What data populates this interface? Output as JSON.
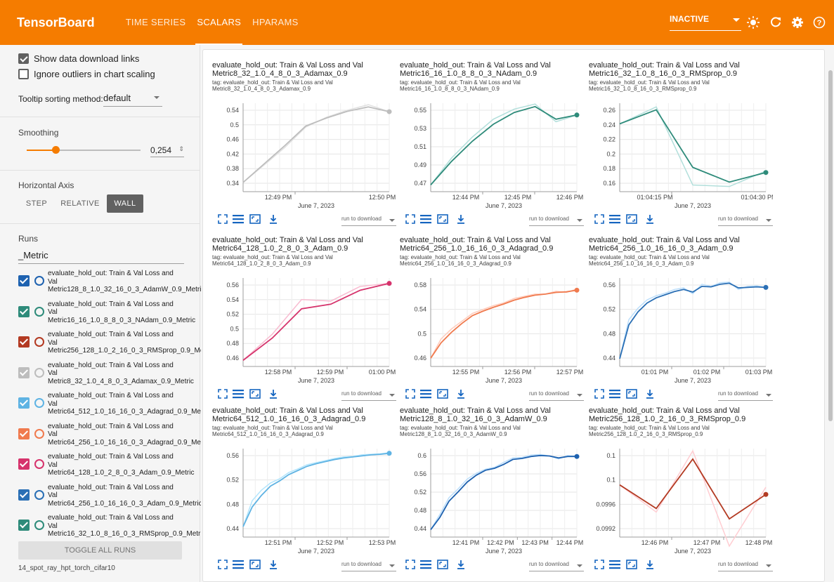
{
  "header": {
    "brand": "TensorBoard",
    "tabs": [
      {
        "label": "TIME SERIES",
        "active": false
      },
      {
        "label": "SCALARS",
        "active": true
      },
      {
        "label": "HPARAMS",
        "active": false
      }
    ],
    "run_select": "INACTIVE",
    "bg_color": "#f57c00"
  },
  "sidebar": {
    "show_download_links": "Show data download links",
    "ignore_outliers": "Ignore outliers in chart scaling",
    "tooltip_label": "Tooltip sorting method:",
    "tooltip_value": "default",
    "smoothing_label": "Smoothing",
    "smoothing_value": "0,254",
    "smoothing_fraction": 0.254,
    "haxis_label": "Horizontal Axis",
    "haxis_options": [
      "STEP",
      "RELATIVE",
      "WALL"
    ],
    "haxis_selected": "WALL",
    "runs_label": "Runs",
    "runs_filter": "_Metric",
    "runs": [
      {
        "label": "evaluate_hold_out: Train & Val Loss and Val Metric128_8_1.0_32_16_0_3_AdamW_0.9_Metric",
        "color": "#1e62b0"
      },
      {
        "label": "evaluate_hold_out: Train & Val Loss and Val Metric16_16_1.0_8_8_0_3_NAdam_0.9_Metric",
        "color": "#2e8b7a"
      },
      {
        "label": "evaluate_hold_out: Train & Val Loss and Val Metric256_128_1.0_2_16_0_3_RMSprop_0.9_Metric",
        "color": "#b33a22"
      },
      {
        "label": "evaluate_hold_out: Train & Val Loss and Val Metric8_32_1.0_4_8_0_3_Adamax_0.9_Metric",
        "color": "#bdbdbd"
      },
      {
        "label": "evaluate_hold_out: Train & Val Loss and Val Metric64_512_1.0_16_16_0_3_Adagrad_0.9_Metric",
        "color": "#5fb3e3"
      },
      {
        "label": "evaluate_hold_out: Train & Val Loss and Val Metric64_256_1.0_16_16_0_3_Adagrad_0.9_Metric",
        "color": "#f07a4e"
      },
      {
        "label": "evaluate_hold_out: Train & Val Loss and Val Metric64_128_1.0_2_8_0_3_Adam_0.9_Metric",
        "color": "#d6336c"
      },
      {
        "label": "evaluate_hold_out: Train & Val Loss and Val Metric64_256_1.0_16_16_0_3_Adam_0.9_Metric",
        "color": "#2a6fb5"
      },
      {
        "label": "evaluate_hold_out: Train & Val Loss and Val Metric16_32_1.0_8_16_0_3_RMSprop_0.9_Metric",
        "color": "#2e8b7a"
      }
    ],
    "toggle_all": "TOGGLE ALL RUNS",
    "experiment": "14_spot_ray_hpt_torch_cifar10"
  },
  "download_label": "run to download",
  "chart_data": [
    {
      "type": "line",
      "title": "evaluate_hold_out: Train & Val Loss and Val Metric8_32_1.0_4_8_0_3_Adamax_0.9",
      "tag": "tag: evaluate_hold_out: Train & Val Loss and Val Metric8_32_1.0_4_8_0_3_Adamax_0.9",
      "xlabel": "June 7, 2023",
      "xticks": [
        "12:49 PM",
        "12:50 PM"
      ],
      "yticks": [
        "0.54",
        "0.5",
        "0.46",
        "0.42",
        "0.38",
        "0.34"
      ],
      "ylim": [
        0.32,
        0.56
      ],
      "color": "#bdbdbd",
      "raw_color": "#e0e0e0",
      "x": [
        0,
        1,
        2,
        3,
        4,
        5,
        6,
        7
      ],
      "values": [
        0.345,
        0.395,
        0.445,
        0.498,
        0.52,
        0.538,
        0.55,
        0.537
      ],
      "raw": [
        0.345,
        0.392,
        0.44,
        0.495,
        0.522,
        0.541,
        0.556,
        0.537
      ]
    },
    {
      "type": "line",
      "title": "evaluate_hold_out: Train & Val Loss and Val Metric16_16_1.0_8_8_0_3_NAdam_0.9",
      "tag": "tag: evaluate_hold_out: Train & Val Loss and Val Metric16_16_1.0_8_8_0_3_NAdam_0.9",
      "xlabel": "June 7, 2023",
      "xticks": [
        "12:44 PM",
        "12:45 PM",
        "12:46 PM"
      ],
      "yticks": [
        "0.55",
        "0.53",
        "0.51",
        "0.49",
        "0.47"
      ],
      "ylim": [
        0.46,
        0.565
      ],
      "color": "#2e8b7a",
      "raw_color": "#b2dfdb",
      "x": [
        0,
        1,
        2,
        3,
        4,
        5,
        6,
        7
      ],
      "values": [
        0.468,
        0.496,
        0.52,
        0.54,
        0.554,
        0.561,
        0.546,
        0.551
      ],
      "raw": [
        0.468,
        0.5,
        0.525,
        0.546,
        0.558,
        0.564,
        0.543,
        0.551
      ]
    },
    {
      "type": "line",
      "title": "evaluate_hold_out: Train & Val Loss and Val Metric16_32_1.0_8_16_0_3_RMSprop_0.9",
      "tag": "tag: evaluate_hold_out: Train & Val Loss and Val Metric16_32_1.0_8_16_0_3_RMSprop_0.9",
      "xlabel": "June 7, 2023",
      "xticks": [
        "01:04:15 PM",
        "01:04:30 PM"
      ],
      "yticks": [
        "0.26",
        "0.24",
        "0.22",
        "0.2",
        "0.18",
        "0.16"
      ],
      "ylim": [
        0.15,
        0.27
      ],
      "color": "#2e8b7a",
      "raw_color": "#b2dfdb",
      "x": [
        0,
        1,
        2,
        3,
        4
      ],
      "values": [
        0.242,
        0.261,
        0.183,
        0.163,
        0.176
      ],
      "raw": [
        0.242,
        0.265,
        0.159,
        0.157,
        0.178
      ]
    },
    {
      "type": "line",
      "title": "evaluate_hold_out: Train & Val Loss and Val Metric64_128_1.0_2_8_0_3_Adam_0.9",
      "tag": "tag: evaluate_hold_out: Train & Val Loss and Val Metric64_128_1.0_2_8_0_3_Adam_0.9",
      "xlabel": "June 7, 2023",
      "xticks": [
        "12:58 PM",
        "12:59 PM",
        "01:00 PM"
      ],
      "yticks": [
        "0.56",
        "0.54",
        "0.52",
        "0.5",
        "0.48",
        "0.46"
      ],
      "ylim": [
        0.45,
        0.565
      ],
      "color": "#d6336c",
      "raw_color": "#f8bbd0",
      "x": [
        0,
        1,
        2,
        3,
        4,
        5
      ],
      "values": [
        0.458,
        0.487,
        0.525,
        0.531,
        0.549,
        0.558
      ],
      "raw": [
        0.458,
        0.492,
        0.537,
        0.535,
        0.554,
        0.558
      ]
    },
    {
      "type": "line",
      "title": "evaluate_hold_out: Train & Val Loss and Val Metric64_256_1.0_16_16_0_3_Adagrad_0.9",
      "tag": "tag: evaluate_hold_out: Train & Val Loss and Val Metric64_256_1.0_16_16_0_3_Adagrad_0.9",
      "xlabel": "June 7, 2023",
      "xticks": [
        "12:55 PM",
        "12:56 PM",
        "12:57 PM"
      ],
      "yticks": [
        "0.58",
        "0.54",
        "0.5",
        "0.46"
      ],
      "ylim": [
        0.44,
        0.6
      ],
      "color": "#f07a4e",
      "raw_color": "#ffccbc",
      "x": [
        0,
        1,
        2,
        3,
        4,
        5,
        6,
        7,
        8,
        9,
        10,
        11,
        12,
        13,
        14
      ],
      "values": [
        0.455,
        0.483,
        0.502,
        0.518,
        0.532,
        0.54,
        0.547,
        0.553,
        0.56,
        0.565,
        0.569,
        0.571,
        0.574,
        0.575,
        0.578
      ],
      "raw": [
        0.455,
        0.49,
        0.508,
        0.522,
        0.536,
        0.543,
        0.55,
        0.555,
        0.563,
        0.567,
        0.571,
        0.571,
        0.576,
        0.574,
        0.58
      ]
    },
    {
      "type": "line",
      "title": "evaluate_hold_out: Train & Val Loss and Val Metric64_256_1.0_16_16_0_3_Adam_0.9",
      "tag": "tag: evaluate_hold_out: Train & Val Loss and Val Metric64_256_1.0_16_16_0_3_Adam_0.9",
      "xlabel": "June 7, 2023",
      "xticks": [
        "01:01 PM",
        "01:02 PM",
        "01:03 PM"
      ],
      "yticks": [
        "0.56",
        "0.52",
        "0.48",
        "0.44"
      ],
      "ylim": [
        0.42,
        0.59
      ],
      "color": "#2a6fb5",
      "raw_color": "#bbdefb",
      "x": [
        0,
        1,
        2,
        3,
        4,
        5,
        6,
        7,
        8,
        9,
        10,
        11,
        12,
        13,
        14,
        15,
        16
      ],
      "values": [
        0.435,
        0.5,
        0.525,
        0.542,
        0.552,
        0.558,
        0.564,
        0.568,
        0.563,
        0.574,
        0.573,
        0.578,
        0.58,
        0.571,
        0.572,
        0.573,
        0.572
      ],
      "raw": [
        0.435,
        0.51,
        0.532,
        0.548,
        0.556,
        0.561,
        0.568,
        0.571,
        0.56,
        0.578,
        0.574,
        0.581,
        0.582,
        0.568,
        0.574,
        0.575,
        0.572
      ]
    },
    {
      "type": "line",
      "title": "evaluate_hold_out: Train & Val Loss and Val Metric64_512_1.0_16_16_0_3_Adagrad_0.9",
      "tag": "tag: evaluate_hold_out: Train & Val Loss and Val Metric64_512_1.0_16_16_0_3_Adagrad_0.9",
      "xlabel": "June 7, 2023",
      "xticks": [
        "12:51 PM",
        "12:52 PM",
        "12:53 PM"
      ],
      "yticks": [
        "0.56",
        "0.52",
        "0.48",
        "0.44"
      ],
      "ylim": [
        0.42,
        0.59
      ],
      "color": "#5fb3e3",
      "raw_color": "#b3e5fc",
      "x": [
        0,
        1,
        2,
        3,
        4,
        5,
        6,
        7,
        8,
        9,
        10,
        11,
        12,
        13,
        14,
        15,
        16
      ],
      "values": [
        0.44,
        0.478,
        0.5,
        0.518,
        0.528,
        0.54,
        0.548,
        0.556,
        0.561,
        0.565,
        0.569,
        0.572,
        0.574,
        0.576,
        0.578,
        0.579,
        0.581
      ],
      "raw": [
        0.44,
        0.49,
        0.51,
        0.524,
        0.532,
        0.544,
        0.551,
        0.559,
        0.563,
        0.567,
        0.571,
        0.574,
        0.575,
        0.578,
        0.579,
        0.58,
        0.582
      ]
    },
    {
      "type": "line",
      "title": "evaluate_hold_out: Train & Val Loss and Val Metric128_8_1.0_32_16_0_3_AdamW_0.9",
      "tag": "tag: evaluate_hold_out: Train & Val Loss and Val Metric128_8_1.0_32_16_0_3_AdamW_0.9",
      "xlabel": "June 7, 2023",
      "xticks": [
        "12:41 PM",
        "12:42 PM",
        "12:43 PM",
        "12:44 PM"
      ],
      "yticks": [
        "0.6",
        "0.56",
        "0.52",
        "0.48",
        "0.44"
      ],
      "ylim": [
        0.43,
        0.61
      ],
      "color": "#1e62b0",
      "raw_color": "#bbdefb",
      "x": [
        0,
        1,
        2,
        3,
        4,
        5,
        6,
        7,
        8,
        9,
        10,
        11,
        12,
        13,
        14,
        15,
        16
      ],
      "values": [
        0.445,
        0.47,
        0.503,
        0.522,
        0.542,
        0.556,
        0.566,
        0.57,
        0.578,
        0.588,
        0.59,
        0.594,
        0.596,
        0.595,
        0.591,
        0.594,
        0.594
      ],
      "raw": [
        0.445,
        0.476,
        0.51,
        0.528,
        0.548,
        0.56,
        0.568,
        0.572,
        0.582,
        0.591,
        0.592,
        0.597,
        0.598,
        0.595,
        0.589,
        0.596,
        0.594
      ]
    },
    {
      "type": "line",
      "title": "evaluate_hold_out: Train & Val Loss and Val Metric256_128_1.0_2_16_0_3_RMSprop_0.9",
      "tag": "tag: evaluate_hold_out: Train & Val Loss and Val Metric256_128_1.0_2_16_0_3_RMSprop_0.9",
      "xlabel": "June 7, 2023",
      "xticks": [
        "12:46 PM",
        "12:47 PM",
        "12:48 PM"
      ],
      "yticks": [
        "0.1",
        "0.1",
        "0.0996",
        "0.0992"
      ],
      "ylim": [
        0.0988,
        0.10075
      ],
      "color": "#b33a22",
      "raw_color": "#ffcdd2",
      "x": [
        0,
        1,
        2,
        3,
        4
      ],
      "values": [
        0.09995,
        0.09943,
        0.10052,
        0.0992,
        0.09974
      ],
      "raw": [
        0.09995,
        0.09935,
        0.1007,
        0.0986,
        0.0999
      ]
    }
  ]
}
